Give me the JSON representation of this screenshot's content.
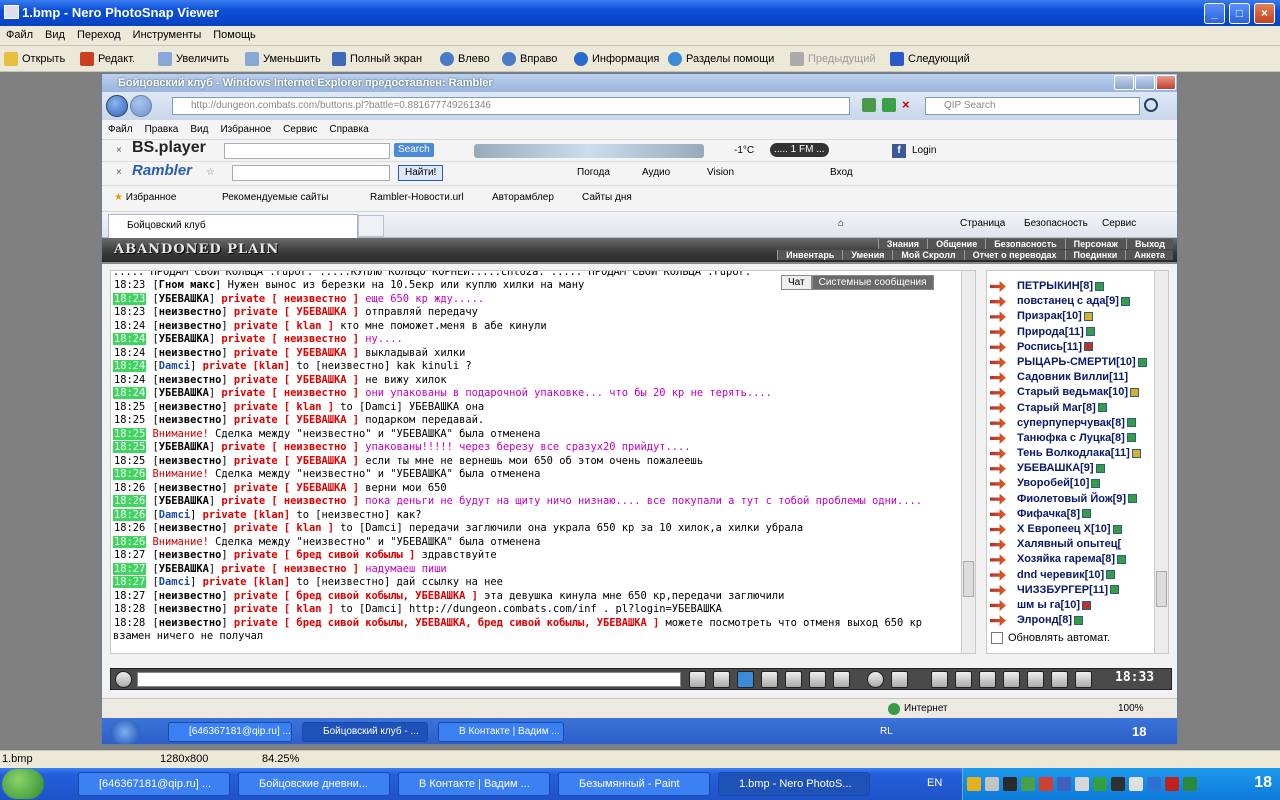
{
  "window": {
    "title": "1.bmp - Nero PhotoSnap Viewer"
  },
  "menu": [
    "Файл",
    "Вид",
    "Переход",
    "Инструменты",
    "Помощь"
  ],
  "toolbar": {
    "open": "Открыть",
    "edit": "Редакт.",
    "zoom_in": "Увеличить",
    "zoom_out": "Уменьшить",
    "fullscreen": "Полный экран",
    "left": "Влево",
    "right": "Вправо",
    "info": "Информация",
    "help": "Разделы помощи",
    "prev": "Предыдущий",
    "next": "Следующий"
  },
  "ie": {
    "title": "Бойцовский клуб - Windows Internet Explorer предоставлен: Rambler",
    "url": "http://dungeon.combats.com/buttons.pl?battle=0.881677749261346",
    "search_placeholder": "QIP Search",
    "menu": [
      "Файл",
      "Правка",
      "Вид",
      "Избранное",
      "Сервис",
      "Справка"
    ],
    "bsplayer": {
      "logo": "BS.player",
      "search": "Search",
      "temp": "-1°C",
      "radio": "..... 1 FM ...",
      "login": "Login"
    },
    "rambler": {
      "logo": "Rambler",
      "find": "Найти!",
      "weather": "Погода",
      "audio": "Аудио",
      "vision": "Vision",
      "login": "Вход"
    },
    "fav": {
      "label": "Избранное",
      "items": [
        "Рекомендуемые сайты",
        "Rambler-Новости.url",
        "Авторамблер",
        "Сайты дня"
      ]
    },
    "tab": "Бойцовский клуб",
    "tab_tools": {
      "page": "Страница",
      "security": "Безопасность",
      "service": "Сервис"
    },
    "status": {
      "zone": "Интернет",
      "zoom": "100%"
    },
    "taskbar": [
      "[646367181@qip.ru] ...",
      "Бойцовский клуб - ...",
      "В Контакте | Вадим ..."
    ],
    "tray_lang": "RL",
    "tray_clock": "18"
  },
  "game": {
    "location": "ABANDONED PLAIN",
    "nav1": [
      "Знания",
      "Общение",
      "Безопасность",
      "Персонаж",
      "Выход"
    ],
    "nav2": [
      "Инвентарь",
      "Умения",
      "Мой Скролл",
      "Отчет о переводах",
      "Поединки",
      "Анкета"
    ],
    "chat_tabs": [
      "Чат",
      "Системные сообщения"
    ],
    "top_line": "::::: ПРОДАМ СВОИ КОЛЬЦА :rupor: :::::КУПЛЮ КОЛЬЦО КОРНЕЙ:::::cnto2a: ::::: ПРОДАМ СВОИ КОЛЬЦА :rupor:",
    "chat": [
      {
        "t": "18:23",
        "g": false,
        "n": "Гном макс",
        "p": "",
        "m": "Нужен вынос из березки на 10.5екр или куплю хилки на ману",
        "c": ""
      },
      {
        "t": "18:23",
        "g": true,
        "n": "УБЕВАШКА",
        "p": "private [ неизвестно ]",
        "m": "еще 650 кр жду.....",
        "c": "mg"
      },
      {
        "t": "18:23",
        "g": false,
        "n": "неизвестно",
        "p": "private [ УБЕВАШКА ]",
        "m": "отправляй передачу",
        "c": ""
      },
      {
        "t": "18:24",
        "g": false,
        "n": "неизвестно",
        "p": "private [ klan ]",
        "m": "кто мне поможет.меня в абе кинули",
        "c": ""
      },
      {
        "t": "18:24",
        "g": true,
        "n": "УБЕВАШКА",
        "p": "private [ неизвестно ]",
        "m": "ну....",
        "c": "mg"
      },
      {
        "t": "18:24",
        "g": false,
        "n": "неизвестно",
        "p": "private [ УБЕВАШКА ]",
        "m": "выкладывай хилки",
        "c": ""
      },
      {
        "t": "18:24",
        "g": true,
        "n": "Damci",
        "p": "private [klan]",
        "m": "to [неизвестно] kak kinuli ?",
        "c": "",
        "b": true
      },
      {
        "t": "18:24",
        "g": false,
        "n": "неизвестно",
        "p": "private [ УБЕВАШКА ]",
        "m": "не вижу хилок",
        "c": ""
      },
      {
        "t": "18:24",
        "g": true,
        "n": "УБЕВАШКА",
        "p": "private [ неизвестно ]",
        "m": "они упакованы в подарочной упаковке... что бы 20 кр не терять....",
        "c": "mg"
      },
      {
        "t": "18:25",
        "g": false,
        "n": "неизвестно",
        "p": "private [ klan ]",
        "m": "to [Damci] УБЕВАШКА она",
        "c": ""
      },
      {
        "t": "18:25",
        "g": false,
        "n": "неизвестно",
        "p": "private [ УБЕВАШКА ]",
        "m": "подарком передавай.",
        "c": ""
      },
      {
        "t": "18:25",
        "g": true,
        "n": "",
        "p": "",
        "m": "Сделка между \"неизвестно\" и \"УБЕВАШКА\" была отменена",
        "c": "",
        "w": "Внимание!"
      },
      {
        "t": "18:25",
        "g": true,
        "n": "УБЕВАШКА",
        "p": "private [ неизвестно ]",
        "m": "упакованы!!!!! через березу все сразух20 прийдут....",
        "c": "mg"
      },
      {
        "t": "18:25",
        "g": false,
        "n": "неизвестно",
        "p": "private [ УБЕВАШКА ]",
        "m": "если ты мне не вернешь мои 650 об этом очень пожалеешь",
        "c": ""
      },
      {
        "t": "18:26",
        "g": true,
        "n": "",
        "p": "",
        "m": "Сделка между \"неизвестно\" и \"УБЕВАШКА\" была отменена",
        "c": "",
        "w": "Внимание!"
      },
      {
        "t": "18:26",
        "g": false,
        "n": "неизвестно",
        "p": "private [ УБЕВАШКА ]",
        "m": "верни мои 650",
        "c": ""
      },
      {
        "t": "18:26",
        "g": true,
        "n": "УБЕВАШКА",
        "p": "private [ неизвестно ]",
        "m": "пока деньги не будут на щиту ничо низнаю.... все покупали а тут с тобой проблемы одни....",
        "c": "mg"
      },
      {
        "t": "18:26",
        "g": true,
        "n": "Damci",
        "p": "private [klan]",
        "m": "to [неизвестно] как?",
        "c": "",
        "b": true
      },
      {
        "t": "18:26",
        "g": false,
        "n": "неизвестно",
        "p": "private [ klan ]",
        "m": "to [Damci] передачи заглючили она украла 650 кр за 10 хилок,а хилки убрала",
        "c": ""
      },
      {
        "t": "18:26",
        "g": true,
        "n": "",
        "p": "",
        "m": "Сделка между \"неизвестно\" и \"УБЕВАШКА\" была отменена",
        "c": "",
        "w": "Внимание!"
      },
      {
        "t": "18:27",
        "g": false,
        "n": "неизвестно",
        "p": "private [ бред сивой кобылы ]",
        "m": "здравствуйте",
        "c": ""
      },
      {
        "t": "18:27",
        "g": true,
        "n": "УБЕВАШКА",
        "p": "private [ неизвестно ]",
        "m": "надумаеш пиши",
        "c": "mg"
      },
      {
        "t": "18:27",
        "g": true,
        "n": "Damci",
        "p": "private [klan]",
        "m": "to [неизвестно] дай ссылку на нее",
        "c": "",
        "b": true
      },
      {
        "t": "18:27",
        "g": false,
        "n": "неизвестно",
        "p": "private [ бред сивой кобылы, УБЕВАШКА ]",
        "m": "эта девушка кинула мне 650 кр,передачи заглючили",
        "c": ""
      },
      {
        "t": "18:28",
        "g": false,
        "n": "неизвестно",
        "p": "private [ klan ]",
        "m": "to [Damci] http://dungeon.combats.com/inf . pl?login=УБЕВАШКА",
        "c": ""
      },
      {
        "t": "18:28",
        "g": false,
        "n": "неизвестно",
        "p": "private [ бред сивой кобылы, УБЕВАШКА, бред сивой кобылы, УБЕВАШКА ]",
        "m": "можете посмотреть что отменя выход 650 кр взамен ничего не получал",
        "c": "",
        "wrap": true
      }
    ],
    "players": [
      {
        "n": "ПЕТРЫКИН[8]",
        "i": "g"
      },
      {
        "n": "повстанец с ада[9]",
        "i": "g"
      },
      {
        "n": "Призрак[10]",
        "i": "y"
      },
      {
        "n": "Природа[11]",
        "i": "g"
      },
      {
        "n": "Роспись[11]",
        "i": "r"
      },
      {
        "n": "РЫЦАРЬ-СМЕРТИ[10]",
        "i": "g"
      },
      {
        "n": "Садовник Вилли[11]",
        "i": ""
      },
      {
        "n": "Старый ведьмак[10]",
        "i": "y"
      },
      {
        "n": "Старый Маг[8]",
        "i": "g"
      },
      {
        "n": "суперпуперчувак[8]",
        "i": "g"
      },
      {
        "n": "Танюфка с Луцка[8]",
        "i": "g"
      },
      {
        "n": "Тень Волкодлака[11]",
        "i": "y"
      },
      {
        "n": "УБЕВАШКА[9]",
        "i": "g"
      },
      {
        "n": "Уворобей[10]",
        "i": "g"
      },
      {
        "n": "Фиолетовый Йож[9]",
        "i": "g"
      },
      {
        "n": "Фифачка[8]",
        "i": "g"
      },
      {
        "n": "Х Европеец Х[10]",
        "i": "g"
      },
      {
        "n": "Халявный опытец[",
        "i": ""
      },
      {
        "n": "Хозяйка гарема[8]",
        "i": "g"
      },
      {
        "n": "dnd черевик[10]",
        "i": "g"
      },
      {
        "n": "ЧИЗЗБУРГЕР[11]",
        "i": "g"
      },
      {
        "n": "шм ы га[10]",
        "i": "r"
      },
      {
        "n": "Элронд[8]",
        "i": "g"
      }
    ],
    "auto_update": "Обновлять автомат.",
    "clock": "18:33"
  },
  "status": {
    "file": "1.bmp",
    "size": "1280x800",
    "zoom": "84.25%"
  },
  "taskbar": {
    "items": [
      "[646367181@qip.ru] ...",
      "Бойцовские дневни...",
      "В Контакте | Вадим ...",
      "Безымянный - Paint",
      "1.bmp - Nero PhotoS..."
    ],
    "lang": "EN",
    "clock": "18"
  }
}
